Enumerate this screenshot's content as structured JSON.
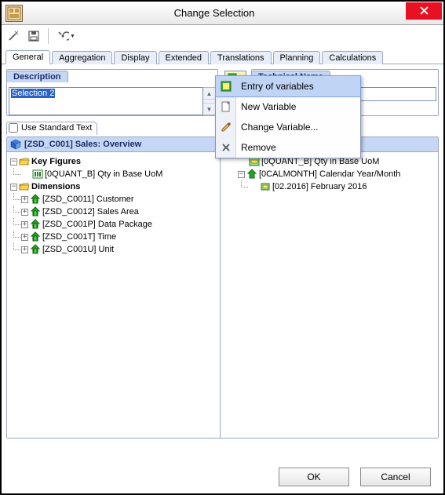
{
  "window": {
    "title": "Change Selection"
  },
  "toolbar": {
    "wand": "wand-icon",
    "save": "save-icon",
    "settings": "settings-icon"
  },
  "tabs": {
    "items": [
      "General",
      "Aggregation",
      "Display",
      "Extended",
      "Translations",
      "Planning",
      "Calculations"
    ],
    "active": "General"
  },
  "description": {
    "label": "Description",
    "value": "Selection 2",
    "use_standard_text": "Use Standard Text"
  },
  "technical_name": {
    "label": "Technical Name",
    "value": ""
  },
  "tree_header": "[ZSD_C001] Sales: Overview",
  "left_tree": {
    "key_figures_label": "Key Figures",
    "key_figures": {
      "item0": "[0QUANT_B] Qty in Base UoM"
    },
    "dimensions_label": "Dimensions",
    "dimensions": {
      "item0": "[ZSD_C0011] Customer",
      "item1": "[ZSD_C0012] Sales Area",
      "item2": "[ZSD_C001P] Data Package",
      "item3": "[ZSD_C001T] Time",
      "item4": "[ZSD_C001U] Unit"
    }
  },
  "right_tree": {
    "item0": "[0QUANT_B] Qty in Base UoM",
    "item1": "[0CALMONTH] Calendar Year/Month",
    "item1_child": "[02.2016] February 2016"
  },
  "context_menu": {
    "item0": "Entry of variables",
    "item1": "New Variable",
    "item2": "Change Variable...",
    "item3": "Remove"
  },
  "footer": {
    "ok": "OK",
    "cancel": "Cancel"
  }
}
